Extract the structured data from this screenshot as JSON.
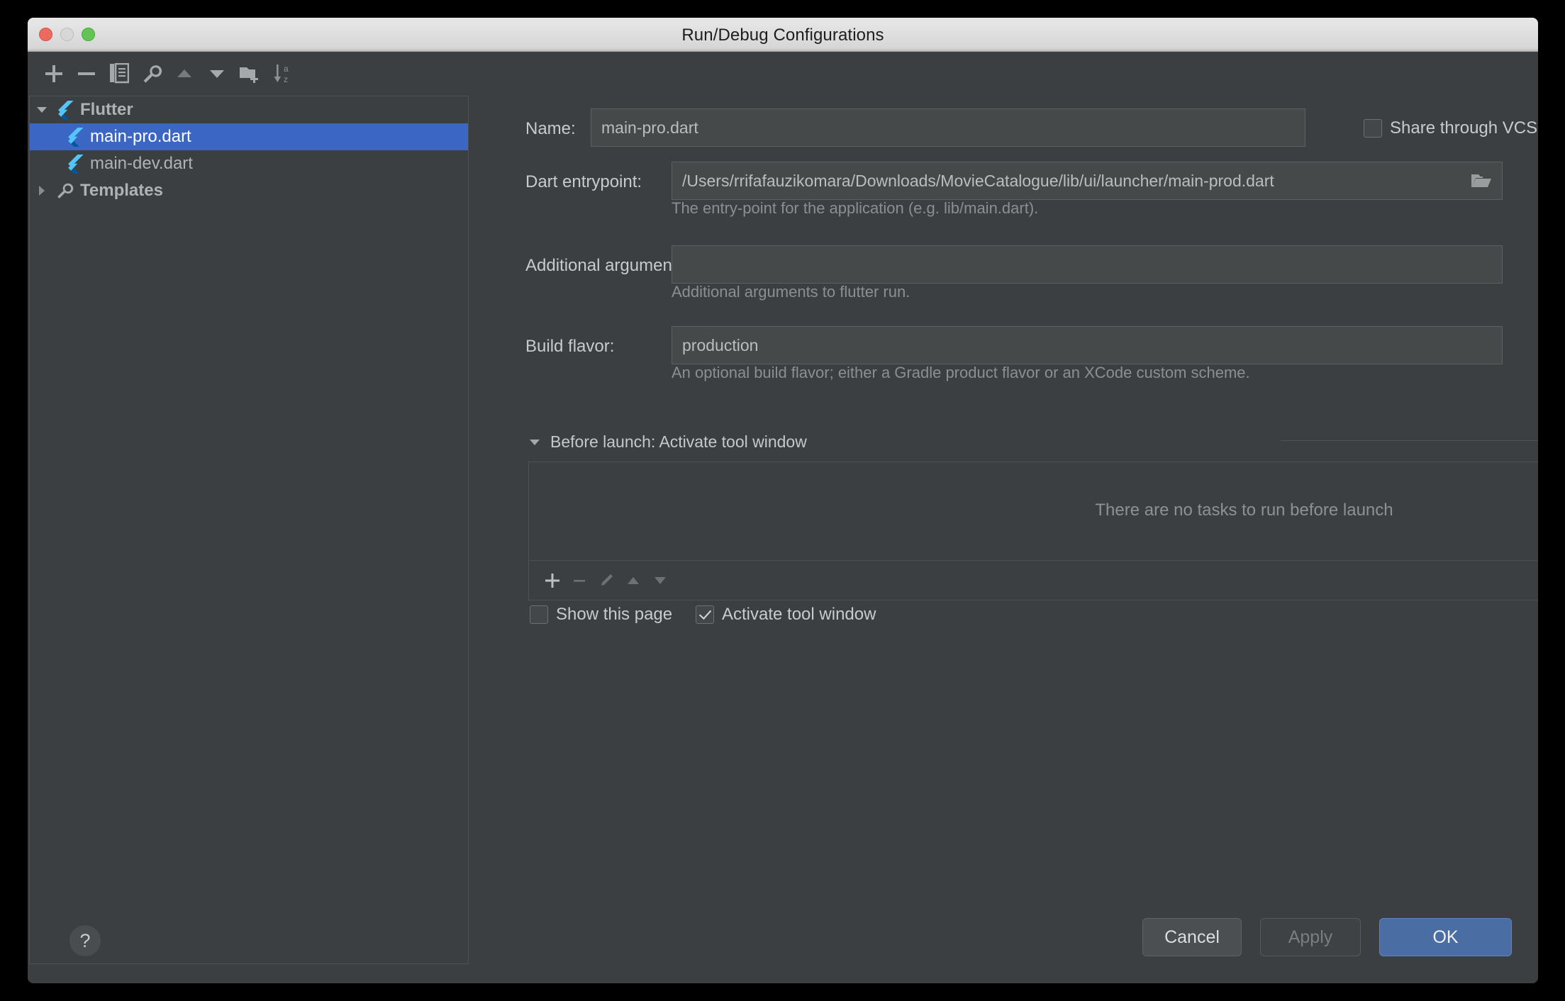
{
  "window": {
    "title": "Run/Debug Configurations",
    "traffic_lights": [
      "close",
      "minimize",
      "zoom"
    ]
  },
  "toolbar": {
    "buttons": [
      {
        "name": "add-configuration",
        "icon": "plus-icon"
      },
      {
        "name": "remove-configuration",
        "icon": "minus-icon"
      },
      {
        "name": "copy-configuration",
        "icon": "copy-icon"
      },
      {
        "name": "edit-templates",
        "icon": "wrench-icon"
      },
      {
        "name": "move-up",
        "icon": "triangle-up-icon"
      },
      {
        "name": "move-down",
        "icon": "triangle-down-icon"
      },
      {
        "name": "create-folder",
        "icon": "folder-add-icon"
      },
      {
        "name": "sort-configurations",
        "icon": "sort-az-icon"
      }
    ]
  },
  "tree": {
    "items": [
      {
        "label": "Flutter",
        "icon": "flutter-icon",
        "level": 0,
        "expanded": true,
        "selected": false,
        "has_twisty": true
      },
      {
        "label": "main-pro.dart",
        "icon": "flutter-icon",
        "level": 1,
        "selected": true,
        "has_twisty": false
      },
      {
        "label": "main-dev.dart",
        "icon": "flutter-icon",
        "level": 1,
        "selected": false,
        "has_twisty": false
      },
      {
        "label": "Templates",
        "icon": "wrench-icon",
        "level": 0,
        "expanded": false,
        "selected": false,
        "has_twisty": true
      }
    ]
  },
  "form": {
    "name_label": "Name:",
    "name_value": "main-pro.dart",
    "share_vcs_label": "Share through VCS",
    "share_vcs_checked": false,
    "entrypoint_label": "Dart entrypoint:",
    "entrypoint_value": "/Users/rrifafauzikomara/Downloads/MovieCatalogue/lib/ui/launcher/main-prod.dart",
    "entrypoint_hint": "The entry-point for the application (e.g. lib/main.dart).",
    "entrypoint_browse_icon": "open-folder-icon",
    "arguments_label": "Additional arguments:",
    "arguments_value": "",
    "arguments_hint": "Additional arguments to flutter run.",
    "flavor_label": "Build flavor:",
    "flavor_value": "production",
    "flavor_hint": "An optional build flavor; either a Gradle product flavor or an XCode custom scheme."
  },
  "before_launch": {
    "header": "Before launch: Activate tool window",
    "expanded": true,
    "empty_message": "There are no tasks to run before launch",
    "toolbar": [
      {
        "name": "add-task",
        "icon": "plus-icon",
        "enabled": true
      },
      {
        "name": "remove-task",
        "icon": "minus-icon",
        "enabled": false
      },
      {
        "name": "edit-task",
        "icon": "pencil-icon",
        "enabled": false
      },
      {
        "name": "move-task-up",
        "icon": "triangle-up-icon",
        "enabled": false
      },
      {
        "name": "move-task-down",
        "icon": "triangle-down-icon",
        "enabled": false
      }
    ],
    "show_page_label": "Show this page",
    "show_page_checked": false,
    "activate_tool_window_label": "Activate tool window",
    "activate_tool_window_checked": true
  },
  "footer": {
    "help_label": "?",
    "cancel_label": "Cancel",
    "apply_label": "Apply",
    "apply_enabled": false,
    "ok_label": "OK"
  },
  "colors": {
    "window_bg": "#3c3f41",
    "titlebar": "#dcdcdc",
    "selection_blue": "#3b66c4",
    "primary_button": "#4a6da3",
    "field_bg": "#45494a",
    "text": "#c8cacc",
    "hint_text": "#8c8f91",
    "flutter_blue": "#54c5f8",
    "flutter_dark": "#0553b1"
  }
}
